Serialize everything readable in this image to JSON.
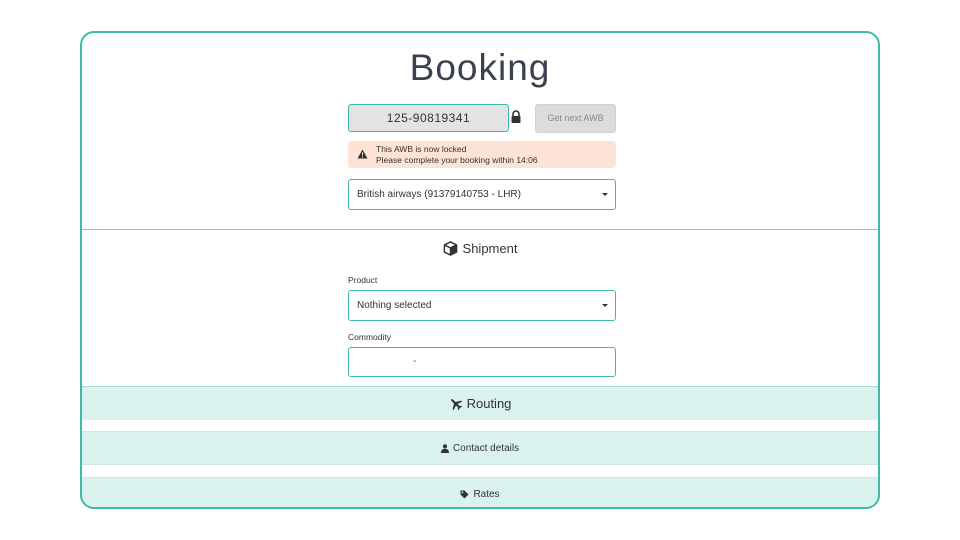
{
  "booking": {
    "title": "Booking",
    "awb_number": "125-90819341",
    "get_next_awb_label": "Get next AWB",
    "alert": {
      "line1": "This AWB is now locked",
      "line2": "Please complete your booking within 14:06"
    },
    "carrier_selected": "British airways (91379140753 - LHR)"
  },
  "shipment": {
    "heading": "Shipment",
    "product_label": "Product",
    "product_selected": "Nothing selected",
    "commodity_label": "Commodity",
    "commodity_value": "-"
  },
  "sections": {
    "routing": "Routing",
    "contact_details": "Contact details",
    "rates": "Rates"
  },
  "icons": {
    "lock": "lock-icon",
    "warning": "warning-icon",
    "box": "box-icon",
    "plane": "plane-icon",
    "user": "user-icon",
    "tag": "tag-icon"
  },
  "colors": {
    "accent": "#3dbba6",
    "band_bg": "#d9f2ed",
    "alert_bg": "#fde3d6",
    "title": "#3c4150"
  }
}
